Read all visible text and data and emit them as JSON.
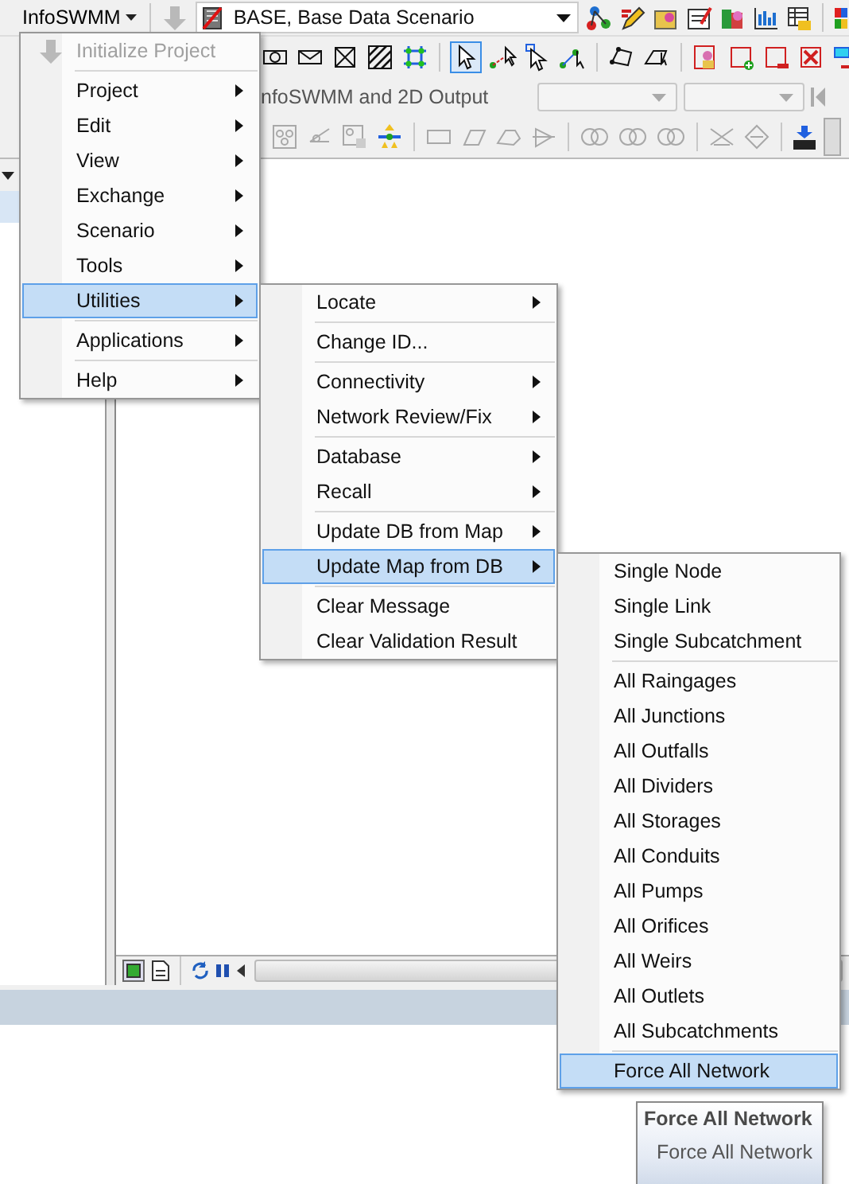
{
  "toolbar": {
    "app_menu": "InfoSWMM",
    "scenario": "BASE, Base Data Scenario",
    "output_label": "nfoSWMM and 2D Output"
  },
  "menus": [
    {
      "items": [
        {
          "kind": "item",
          "label": "Initialize Project",
          "icon": true,
          "submenu": false,
          "selected": false,
          "disabled": true
        },
        {
          "kind": "separator"
        },
        {
          "kind": "item",
          "label": "Project",
          "icon": false,
          "submenu": true,
          "selected": false,
          "disabled": false
        },
        {
          "kind": "item",
          "label": "Edit",
          "icon": false,
          "submenu": true,
          "selected": false,
          "disabled": false
        },
        {
          "kind": "item",
          "label": "View",
          "icon": false,
          "submenu": true,
          "selected": false,
          "disabled": false
        },
        {
          "kind": "item",
          "label": "Exchange",
          "icon": false,
          "submenu": true,
          "selected": false,
          "disabled": false
        },
        {
          "kind": "item",
          "label": "Scenario",
          "icon": false,
          "submenu": true,
          "selected": false,
          "disabled": false
        },
        {
          "kind": "item",
          "label": "Tools",
          "icon": false,
          "submenu": true,
          "selected": false,
          "disabled": false
        },
        {
          "kind": "item",
          "label": "Utilities",
          "icon": false,
          "submenu": true,
          "selected": true,
          "disabled": false
        },
        {
          "kind": "separator"
        },
        {
          "kind": "item",
          "label": "Applications",
          "icon": false,
          "submenu": true,
          "selected": false,
          "disabled": false
        },
        {
          "kind": "separator"
        },
        {
          "kind": "item",
          "label": "Help",
          "icon": false,
          "submenu": true,
          "selected": false,
          "disabled": false
        }
      ]
    },
    {
      "items": [
        {
          "kind": "item",
          "label": "Locate",
          "icon": false,
          "submenu": true,
          "selected": false,
          "disabled": false
        },
        {
          "kind": "separator"
        },
        {
          "kind": "item",
          "label": "Change ID...",
          "icon": false,
          "submenu": false,
          "selected": false,
          "disabled": false
        },
        {
          "kind": "separator"
        },
        {
          "kind": "item",
          "label": "Connectivity",
          "icon": false,
          "submenu": true,
          "selected": false,
          "disabled": false
        },
        {
          "kind": "item",
          "label": "Network Review/Fix",
          "icon": false,
          "submenu": true,
          "selected": false,
          "disabled": false
        },
        {
          "kind": "separator"
        },
        {
          "kind": "item",
          "label": "Database",
          "icon": false,
          "submenu": true,
          "selected": false,
          "disabled": false
        },
        {
          "kind": "item",
          "label": "Recall",
          "icon": false,
          "submenu": true,
          "selected": false,
          "disabled": false
        },
        {
          "kind": "separator"
        },
        {
          "kind": "item",
          "label": "Update DB from Map",
          "icon": false,
          "submenu": true,
          "selected": false,
          "disabled": false
        },
        {
          "kind": "item",
          "label": "Update Map from DB",
          "icon": false,
          "submenu": true,
          "selected": true,
          "disabled": false
        },
        {
          "kind": "separator"
        },
        {
          "kind": "item",
          "label": "Clear Message",
          "icon": false,
          "submenu": false,
          "selected": false,
          "disabled": false
        },
        {
          "kind": "item",
          "label": "Clear Validation Result",
          "icon": false,
          "submenu": false,
          "selected": false,
          "disabled": false
        }
      ]
    },
    {
      "items": [
        {
          "kind": "item",
          "label": "Single Node",
          "icon": false,
          "submenu": false,
          "selected": false,
          "disabled": false
        },
        {
          "kind": "item",
          "label": "Single Link",
          "icon": false,
          "submenu": false,
          "selected": false,
          "disabled": false
        },
        {
          "kind": "item",
          "label": "Single Subcatchment",
          "icon": false,
          "submenu": false,
          "selected": false,
          "disabled": false
        },
        {
          "kind": "separator"
        },
        {
          "kind": "item",
          "label": "All Raingages",
          "icon": false,
          "submenu": false,
          "selected": false,
          "disabled": false
        },
        {
          "kind": "item",
          "label": "All Junctions",
          "icon": false,
          "submenu": false,
          "selected": false,
          "disabled": false
        },
        {
          "kind": "item",
          "label": "All Outfalls",
          "icon": false,
          "submenu": false,
          "selected": false,
          "disabled": false
        },
        {
          "kind": "item",
          "label": "All Dividers",
          "icon": false,
          "submenu": false,
          "selected": false,
          "disabled": false
        },
        {
          "kind": "item",
          "label": "All Storages",
          "icon": false,
          "submenu": false,
          "selected": false,
          "disabled": false
        },
        {
          "kind": "item",
          "label": "All Conduits",
          "icon": false,
          "submenu": false,
          "selected": false,
          "disabled": false
        },
        {
          "kind": "item",
          "label": "All Pumps",
          "icon": false,
          "submenu": false,
          "selected": false,
          "disabled": false
        },
        {
          "kind": "item",
          "label": "All Orifices",
          "icon": false,
          "submenu": false,
          "selected": false,
          "disabled": false
        },
        {
          "kind": "item",
          "label": "All Weirs",
          "icon": false,
          "submenu": false,
          "selected": false,
          "disabled": false
        },
        {
          "kind": "item",
          "label": "All Outlets",
          "icon": false,
          "submenu": false,
          "selected": false,
          "disabled": false
        },
        {
          "kind": "item",
          "label": "All Subcatchments",
          "icon": false,
          "submenu": false,
          "selected": false,
          "disabled": false
        },
        {
          "kind": "separator"
        },
        {
          "kind": "item",
          "label": "Force All Network",
          "icon": false,
          "submenu": false,
          "selected": true,
          "disabled": false
        }
      ]
    }
  ],
  "tooltip": {
    "title": "Force All Network",
    "text": "Force All Network"
  }
}
